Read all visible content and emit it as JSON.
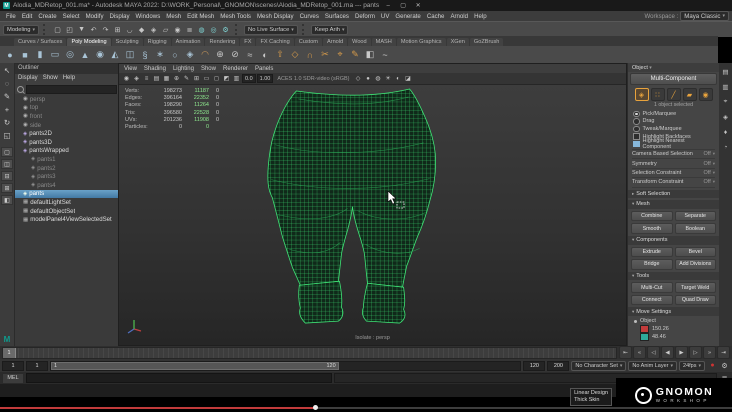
{
  "title_bar": {
    "logo_letter": "M",
    "title": "Alodia_MDRetop_001.ma* - Autodesk MAYA 2022: D:\\WORK_Personal\\_GNOMON\\scenes\\Alodia_MDRetop_001.ma --- pants",
    "minimize": "–",
    "maximize": "▢",
    "close": "✕"
  },
  "menu_bar": {
    "items": [
      "File",
      "Edit",
      "Create",
      "Select",
      "Modify",
      "Display",
      "Windows",
      "Mesh",
      "Edit Mesh",
      "Mesh Tools",
      "Mesh Display",
      "Curves",
      "Surfaces",
      "Deform",
      "UV",
      "Generate",
      "Cache",
      "Arnold",
      "Help"
    ],
    "workspace_label": "Workspace :",
    "workspace_value": "Maya Classic"
  },
  "status_line": {
    "menuset": "Modeling",
    "live_surface": "No Live Surface",
    "keep_dropdown": "Keep Arih",
    "icons": [
      {
        "name": "new-scene-icon",
        "glyph": "▢"
      },
      {
        "name": "open-scene-icon",
        "glyph": "◰"
      },
      {
        "name": "save-scene-icon",
        "glyph": "▼"
      },
      {
        "name": "undo-icon",
        "glyph": "↶"
      },
      {
        "name": "redo-icon",
        "glyph": "↷"
      },
      {
        "name": "snap-grid-icon",
        "glyph": "⊞"
      },
      {
        "name": "snap-curve-icon",
        "glyph": "◡"
      },
      {
        "name": "snap-point-icon",
        "glyph": "◆"
      },
      {
        "name": "snap-projected-icon",
        "glyph": "◈"
      },
      {
        "name": "snap-plane-icon",
        "glyph": "▱"
      },
      {
        "name": "make-live-icon",
        "glyph": "◉"
      },
      {
        "name": "construction-history-icon",
        "glyph": "≣"
      },
      {
        "name": "render-current-frame-icon",
        "glyph": "◍",
        "c": "#7fd4d4"
      },
      {
        "name": "ipr-render-icon",
        "glyph": "◎",
        "c": "#7fd4d4"
      },
      {
        "name": "render-settings-icon",
        "glyph": "⚙",
        "c": "#7fd4d4"
      }
    ]
  },
  "shelf": {
    "tabs": [
      {
        "label": "Curves / Surfaces"
      },
      {
        "label": "Poly Modeling",
        "active": true
      },
      {
        "label": "Sculpting"
      },
      {
        "label": "Rigging"
      },
      {
        "label": "Animation"
      },
      {
        "label": "Rendering"
      },
      {
        "label": "FX"
      },
      {
        "label": "FX Caching"
      },
      {
        "label": "Custom"
      },
      {
        "label": "Arnold"
      },
      {
        "label": "Wood"
      },
      {
        "label": "MASH"
      },
      {
        "label": "Motion Graphics"
      },
      {
        "label": "XGen"
      },
      {
        "label": "GoZBrush"
      }
    ],
    "icons": [
      {
        "name": "poly-sphere-icon",
        "glyph": "●",
        "c": "#a9c4d6"
      },
      {
        "name": "poly-cube-icon",
        "glyph": "■",
        "c": "#a9c4d6"
      },
      {
        "name": "poly-cylinder-icon",
        "glyph": "▮",
        "c": "#a9c4d6"
      },
      {
        "name": "poly-plane-icon",
        "glyph": "▭",
        "c": "#a9c4d6"
      },
      {
        "name": "poly-torus-icon",
        "glyph": "◎",
        "c": "#a9c4d6"
      },
      {
        "name": "poly-cone-icon",
        "glyph": "▲",
        "c": "#a9c4d6"
      },
      {
        "name": "poly-disc-icon",
        "glyph": "◉",
        "c": "#a9c4d6"
      },
      {
        "name": "poly-pyramid-icon",
        "glyph": "◭",
        "c": "#a9c4d6"
      },
      {
        "name": "poly-pipe-icon",
        "glyph": "◫",
        "c": "#a9c4d6"
      },
      {
        "name": "poly-helix-icon",
        "glyph": "§",
        "c": "#a9c4d6"
      },
      {
        "name": "poly-gear-icon",
        "glyph": "∗",
        "c": "#a9c4d6"
      },
      {
        "name": "poly-soccerball-icon",
        "glyph": "○",
        "c": "#a9c4d6"
      },
      {
        "name": "platonic-solid-icon",
        "glyph": "◈",
        "c": "#a9c4d6"
      },
      {
        "name": "sculpt-tool-icon",
        "glyph": "◠",
        "c": "#c8975a"
      },
      {
        "name": "combine-icon",
        "glyph": "⊕",
        "c": "#c8c8c8"
      },
      {
        "name": "separate-icon",
        "glyph": "⊘",
        "c": "#c8c8c8"
      },
      {
        "name": "smooth-icon",
        "glyph": "≈",
        "c": "#c8c8c8"
      },
      {
        "name": "boolean-icon",
        "glyph": "◐",
        "c": "#c8c8c8"
      },
      {
        "name": "extrude-icon",
        "glyph": "⇧",
        "c": "#d79b4a"
      },
      {
        "name": "bevel-icon",
        "glyph": "◇",
        "c": "#d79b4a"
      },
      {
        "name": "bridge-icon",
        "glyph": "∩",
        "c": "#d79b4a"
      },
      {
        "name": "multi-cut-icon",
        "glyph": "✂",
        "c": "#d79b4a"
      },
      {
        "name": "target-weld-icon",
        "glyph": "⌖",
        "c": "#d79b4a"
      },
      {
        "name": "quad-draw-icon",
        "glyph": "✎",
        "c": "#d79b4a"
      },
      {
        "name": "mirror-icon",
        "glyph": "◧",
        "c": "#c8c8c8"
      },
      {
        "name": "curve-tool-icon",
        "glyph": "~",
        "c": "#c8c8c8"
      }
    ]
  },
  "toolbox": {
    "tools": [
      {
        "name": "select-tool-icon",
        "glyph": "↖"
      },
      {
        "name": "lasso-select-tool-icon",
        "glyph": "◌"
      },
      {
        "name": "paint-select-tool-icon",
        "glyph": "✎"
      },
      {
        "name": "move-tool-icon",
        "glyph": "+"
      },
      {
        "name": "rotate-tool-icon",
        "glyph": "↻"
      },
      {
        "name": "scale-tool-icon",
        "glyph": "◱"
      }
    ],
    "layouts": [
      {
        "name": "layout-single-icon",
        "glyph": "▢"
      },
      {
        "name": "layout-two-side-icon",
        "glyph": "◫"
      },
      {
        "name": "layout-two-stack-icon",
        "glyph": "⊟"
      },
      {
        "name": "layout-four-pane-icon",
        "glyph": "⊞"
      },
      {
        "name": "layout-outliner-persp-icon",
        "glyph": "◧"
      }
    ]
  },
  "outliner": {
    "title": "Outliner",
    "menus": [
      "Display",
      "Show",
      "Help"
    ],
    "filter_value": "",
    "items": [
      {
        "label": "persp",
        "glyph": "◉",
        "c": "#b5b5b5",
        "dim": true
      },
      {
        "label": "top",
        "glyph": "◉",
        "c": "#b5b5b5",
        "dim": true
      },
      {
        "label": "front",
        "glyph": "◉",
        "c": "#b5b5b5",
        "dim": true
      },
      {
        "label": "side",
        "glyph": "◉",
        "c": "#b5b5b5",
        "dim": true
      },
      {
        "label": "pants2D",
        "glyph": "◈",
        "c": "#b9a6e0"
      },
      {
        "label": "pants3D",
        "glyph": "◈",
        "c": "#b9a6e0"
      },
      {
        "label": "pantsWrapped",
        "glyph": "◈",
        "c": "#b9a6e0"
      },
      {
        "label": "pants1",
        "glyph": "◈",
        "c": "#8f8f8f",
        "dim": true,
        "lvl2": true
      },
      {
        "label": "pants2",
        "glyph": "◈",
        "c": "#8f8f8f",
        "dim": true,
        "lvl2": true
      },
      {
        "label": "pants3",
        "glyph": "◈",
        "c": "#8f8f8f",
        "dim": true,
        "lvl2": true
      },
      {
        "label": "pants4",
        "glyph": "◈",
        "c": "#8f8f8f",
        "dim": true,
        "lvl2": true
      },
      {
        "label": "pants",
        "glyph": "◈",
        "c": "#eafaea",
        "selected": true
      },
      {
        "label": "defaultLightSet",
        "glyph": "▦",
        "c": "#b5b5b5"
      },
      {
        "label": "defaultObjectSet",
        "glyph": "▦",
        "c": "#b5b5b5"
      },
      {
        "label": "modelPanel4ViewSelectedSet",
        "glyph": "▦",
        "c": "#b5b5b5"
      }
    ]
  },
  "viewport": {
    "menus": [
      "View",
      "Shading",
      "Lighting",
      "Show",
      "Renderer",
      "Panels"
    ],
    "left_icons": [
      {
        "name": "select-camera-icon",
        "glyph": "◉"
      },
      {
        "name": "lock-camera-icon",
        "glyph": "◈"
      },
      {
        "name": "camera-attributes-icon",
        "glyph": "≡"
      },
      {
        "name": "bookmarks-icon",
        "glyph": "▤"
      },
      {
        "name": "image-plane-icon",
        "glyph": "▦"
      },
      {
        "name": "two-d-pan-zoom-icon",
        "glyph": "⊕"
      },
      {
        "name": "grease-pencil-icon",
        "glyph": "✎"
      },
      {
        "name": "grid-toggle-icon",
        "glyph": "⊞"
      },
      {
        "name": "film-gate-icon",
        "glyph": "▭"
      },
      {
        "name": "resolution-gate-icon",
        "glyph": "◻"
      },
      {
        "name": "gate-mask-icon",
        "glyph": "◩"
      },
      {
        "name": "field-chart-icon",
        "glyph": "▥"
      }
    ],
    "exposure": "0.0",
    "gamma": "1.00",
    "colorspace": "ACES 1.0 SDR-video (sRGB)",
    "right_icons": [
      {
        "name": "wireframe-display-icon",
        "glyph": "◇"
      },
      {
        "name": "shaded-display-icon",
        "glyph": "●"
      },
      {
        "name": "textured-display-icon",
        "glyph": "◍"
      },
      {
        "name": "lights-toggle-icon",
        "glyph": "☀"
      },
      {
        "name": "shadows-toggle-icon",
        "glyph": "◐"
      },
      {
        "name": "xray-toggle-icon",
        "glyph": "◪"
      }
    ],
    "hud": {
      "rows": [
        {
          "label": "Verts:",
          "total": "198273",
          "selected": "11187",
          "extra": "0"
        },
        {
          "label": "Edges:",
          "total": "396164",
          "selected": "22352",
          "extra": "0"
        },
        {
          "label": "Faces:",
          "total": "198290",
          "selected": "11264",
          "extra": "0"
        },
        {
          "label": "Tris:",
          "total": "396580",
          "selected": "22528",
          "extra": "0"
        },
        {
          "label": "UVs:",
          "total": "201236",
          "selected": "11908",
          "extra": "0"
        },
        {
          "label": "Particles:",
          "total": "0",
          "selected": "0",
          "extra": ""
        }
      ]
    },
    "camera_label": "Isolate : persp",
    "wire_color": "#3fe476"
  },
  "toolkit": {
    "header": "Object",
    "tool_title": "Multi-Component",
    "selection_info": "1 object selected",
    "modes": [
      {
        "name": "multi-component-mode-icon",
        "glyph": "◈",
        "active": true
      },
      {
        "name": "vertex-mode-icon",
        "glyph": "∷"
      },
      {
        "name": "edge-mode-icon",
        "glyph": "╱"
      },
      {
        "name": "face-mode-icon",
        "glyph": "▰"
      },
      {
        "name": "uv-mode-icon",
        "glyph": "◉"
      }
    ],
    "options": [
      {
        "label": "Pick/Marquee",
        "radio": true,
        "on": true
      },
      {
        "label": "Drag",
        "radio": true
      },
      {
        "label": "Tweak/Marquee",
        "radio": true
      },
      {
        "label": "Highlight Backfaces",
        "check": true
      },
      {
        "label": "Highlight Nearest Component",
        "check": true,
        "on": true
      }
    ],
    "constraints": [
      {
        "label": "Camera Based Selection",
        "value": "Off"
      },
      {
        "label": "Symmetry",
        "value": "Off"
      },
      {
        "label": "Selection Constraint",
        "value": "Off"
      },
      {
        "label": "Transform Constraint",
        "value": "Off"
      }
    ],
    "soft_selection": "Soft Selection",
    "mesh_title": "Mesh",
    "mesh_buttons": [
      "Combine",
      "Separate",
      "Smooth",
      "Boolean"
    ],
    "components_title": "Components",
    "components_buttons": [
      "Extrude",
      "Bevel",
      "Bridge",
      "Add Divisions"
    ],
    "tools_title": "Tools",
    "tools_buttons": [
      "Multi-Cut",
      "Target Weld",
      "Connect",
      "Quad Draw"
    ],
    "move_title": "Move Settings",
    "object_label": "Object",
    "readout": [
      {
        "name": "red-value-swatch",
        "c": "#c23b3b",
        "text": "150.26"
      },
      {
        "name": "teal-value-swatch",
        "c": "#2fa89a",
        "text": "48.46"
      }
    ]
  },
  "right_strip": {
    "icons": [
      {
        "name": "channel-box-icon",
        "glyph": "▤"
      },
      {
        "name": "attribute-editor-icon",
        "glyph": "▥"
      },
      {
        "name": "tool-settings-icon",
        "glyph": "⌖"
      },
      {
        "name": "modeling-toolkit-icon",
        "glyph": "◈"
      },
      {
        "name": "human-ik-icon",
        "glyph": "♦"
      },
      {
        "name": "xgen-editor-icon",
        "glyph": "◔"
      }
    ]
  },
  "time_slider": {
    "current": "1",
    "playback": [
      {
        "name": "go-to-start-button",
        "glyph": "⇤"
      },
      {
        "name": "step-back-key-button",
        "glyph": "«"
      },
      {
        "name": "step-back-frame-button",
        "glyph": "◁"
      },
      {
        "name": "play-backwards-button",
        "glyph": "◀"
      },
      {
        "name": "play-forward-button",
        "glyph": "▶"
      },
      {
        "name": "step-forward-frame-button",
        "glyph": "▷"
      },
      {
        "name": "step-forward-key-button",
        "glyph": "»"
      },
      {
        "name": "go-to-end-button",
        "glyph": "⇥"
      }
    ]
  },
  "range_slider": {
    "anim_start": "1",
    "play_start": "1",
    "handle_start": "1",
    "handle_end": "120",
    "play_end": "120",
    "anim_end": "200",
    "character_set": "No Character Set",
    "anim_layer": "No Anim Layer",
    "fps": "24fps",
    "icons": [
      {
        "name": "auto-key-icon",
        "glyph": "●",
        "c": "#cc3333"
      },
      {
        "name": "animation-preferences-icon",
        "glyph": "⚙"
      }
    ]
  },
  "command_line": {
    "mode": "MEL",
    "input_value": "",
    "output_value": ""
  },
  "help_line": {
    "text": ""
  },
  "video": {
    "progress_pct": 43,
    "chapters": [
      "Linear Design",
      "Thick Skin"
    ],
    "brand_top": "GNOMON",
    "brand_bottom": "WORKSHOP"
  }
}
